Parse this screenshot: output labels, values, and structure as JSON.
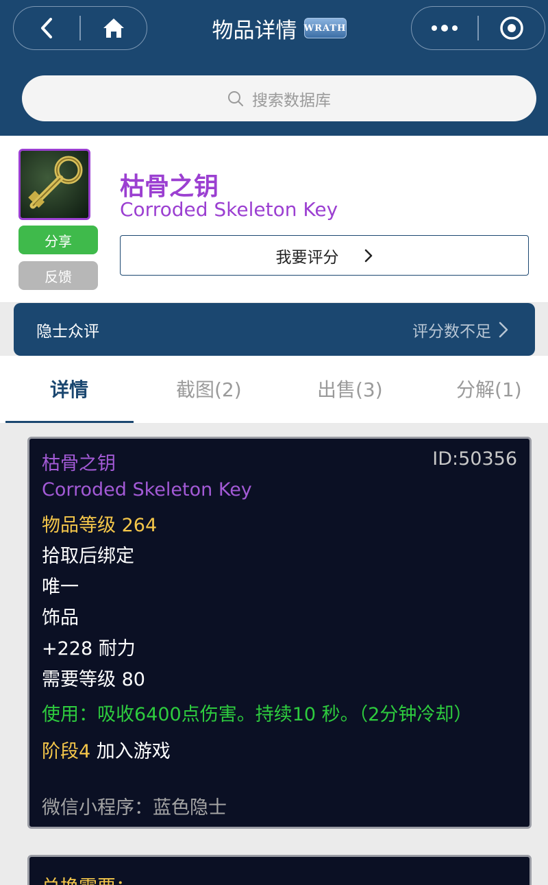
{
  "header": {
    "title": "物品详情",
    "badge": "WRATH",
    "search_placeholder": "搜索数据库"
  },
  "item": {
    "name_cn": "枯骨之钥",
    "name_en": "Corroded Skeleton Key",
    "share_label": "分享",
    "feedback_label": "反馈",
    "rate_label": "我要评分"
  },
  "review": {
    "label": "隐士众评",
    "status": "评分数不足"
  },
  "tabs": [
    {
      "label": "详情"
    },
    {
      "label": "截图(2)"
    },
    {
      "label": "出售(3)"
    },
    {
      "label": "分解(1)"
    }
  ],
  "tooltip": {
    "name_cn": "枯骨之钥",
    "id": "ID:50356",
    "name_en": "Corroded Skeleton Key",
    "item_level": "物品等级 264",
    "bind": "拾取后绑定",
    "unique": "唯一",
    "slot": "饰品",
    "stat": "+228 耐力",
    "req_level": "需要等级 80",
    "use": "使用：吸收6400点伤害。持续10 秒。（2分钟冷却）",
    "phase_label": "阶段4",
    "phase_text": " 加入游戏",
    "source": "微信小程序：蓝色隐士"
  },
  "tooltip2": {
    "title": "兑换需要："
  },
  "colors": {
    "brand": "#1b4770",
    "epic": "#a35ad6",
    "gold": "#f4c64a",
    "green": "#2ecc3e",
    "share": "#3fba4b"
  }
}
